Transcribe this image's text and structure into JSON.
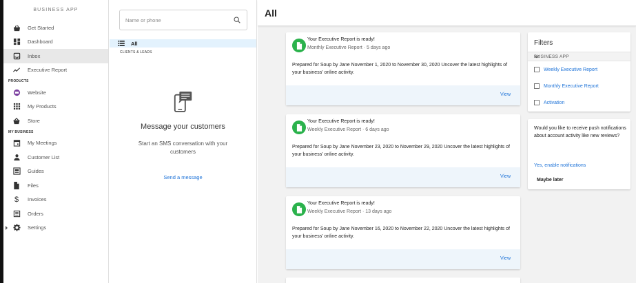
{
  "sidebar": {
    "app_title": "BUSINESS APP",
    "items_top": [
      {
        "label": "Get Started",
        "icon": "shopping-bag-icon"
      },
      {
        "label": "Dashboard",
        "icon": "dashboard-icon"
      },
      {
        "label": "Inbox",
        "icon": "inbox-icon",
        "active": true
      },
      {
        "label": "Executive Report",
        "icon": "trending-icon"
      }
    ],
    "section_products": "PRODUCTS",
    "items_products": [
      {
        "label": "Website",
        "icon": "website-icon"
      },
      {
        "label": "My Products",
        "icon": "grid-icon"
      },
      {
        "label": "Store",
        "icon": "store-icon"
      }
    ],
    "section_business": "MY BUSINESS",
    "items_business": [
      {
        "label": "My Meetings",
        "icon": "calendar-icon"
      },
      {
        "label": "Customer List",
        "icon": "person-icon"
      },
      {
        "label": "Guides",
        "icon": "guides-icon"
      },
      {
        "label": "Files",
        "icon": "file-icon"
      },
      {
        "label": "Invoices",
        "icon": "dollar-icon"
      },
      {
        "label": "Orders",
        "icon": "orders-icon"
      },
      {
        "label": "Settings",
        "icon": "gear-icon"
      }
    ]
  },
  "inbox": {
    "search_placeholder": "Name or phone",
    "all_label": "All",
    "clients_label": "CLIENTS & LEADS",
    "empty_title": "Message your customers",
    "empty_text": "Start an SMS conversation with your customers",
    "empty_link": "Send a message"
  },
  "main": {
    "title": "All",
    "cards": [
      {
        "title": "Your Executive Report is ready!",
        "subtitle": "Monthly Executive Report · 5 days ago",
        "body": "Prepared for Soup by Jane November 1, 2020 to November 30, 2020 Uncover the latest highlights of your business' online activity.",
        "action": "View"
      },
      {
        "title": "Your Executive Report is ready!",
        "subtitle": "Weekly Executive Report · 6 days ago",
        "body": "Prepared for Soup by Jane November 23, 2020 to November 29, 2020 Uncover the latest highlights of your business' online activity.",
        "action": "View"
      },
      {
        "title": "Your Executive Report is ready!",
        "subtitle": "Weekly Executive Report · 13 days ago",
        "body": "Prepared for Soup by Jane November 16, 2020 to November 22, 2020 Uncover the latest highlights of your business' online activity.",
        "action": "View"
      }
    ]
  },
  "filters": {
    "title": "Filters",
    "section": "BUSINESS APP",
    "options": [
      "Weekly Executive Report",
      "Monthly Executive Report",
      "Activation"
    ]
  },
  "push": {
    "text": "Would you like to receive push notifications about account activity like new reviews?",
    "enable": "Yes, enable notifications",
    "later": "Maybe later"
  },
  "colors": {
    "accent": "#1e73d8",
    "report_avatar": "#2bb24c",
    "selected_bg": "#e3f2fd",
    "footer_bg": "#eef5fb"
  }
}
